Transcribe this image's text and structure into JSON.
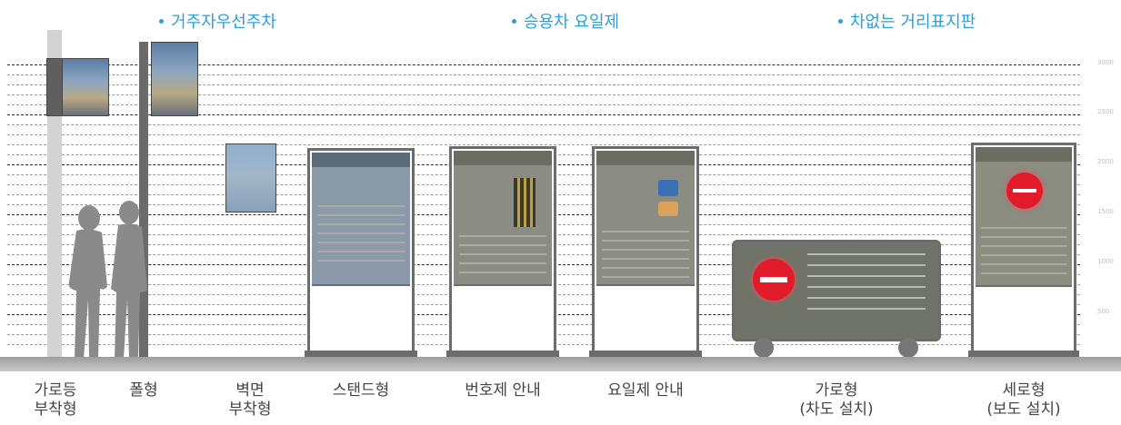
{
  "categories": [
    {
      "label": "거주자우선주차"
    },
    {
      "label": "승용차 요일제"
    },
    {
      "label": "차없는 거리표지판"
    }
  ],
  "scale_marks": [
    "3000",
    "2500",
    "2000",
    "1500",
    "1000",
    "500"
  ],
  "items": [
    {
      "line1": "가로등",
      "line2": "부착형"
    },
    {
      "line1": "폴형",
      "line2": ""
    },
    {
      "line1": "벽면",
      "line2": "부착형"
    },
    {
      "line1": "스탠드형",
      "line2": ""
    },
    {
      "line1": "번호제 안내",
      "line2": ""
    },
    {
      "line1": "요일제 안내",
      "line2": ""
    },
    {
      "line1": "가로형",
      "line2": "(차도 설치)"
    },
    {
      "line1": "세로형",
      "line2": "(보도 설치)"
    }
  ],
  "colors": {
    "category": "#2a9fd8",
    "sign_red": "#e21b2a",
    "frame": "#6c6c6c"
  }
}
